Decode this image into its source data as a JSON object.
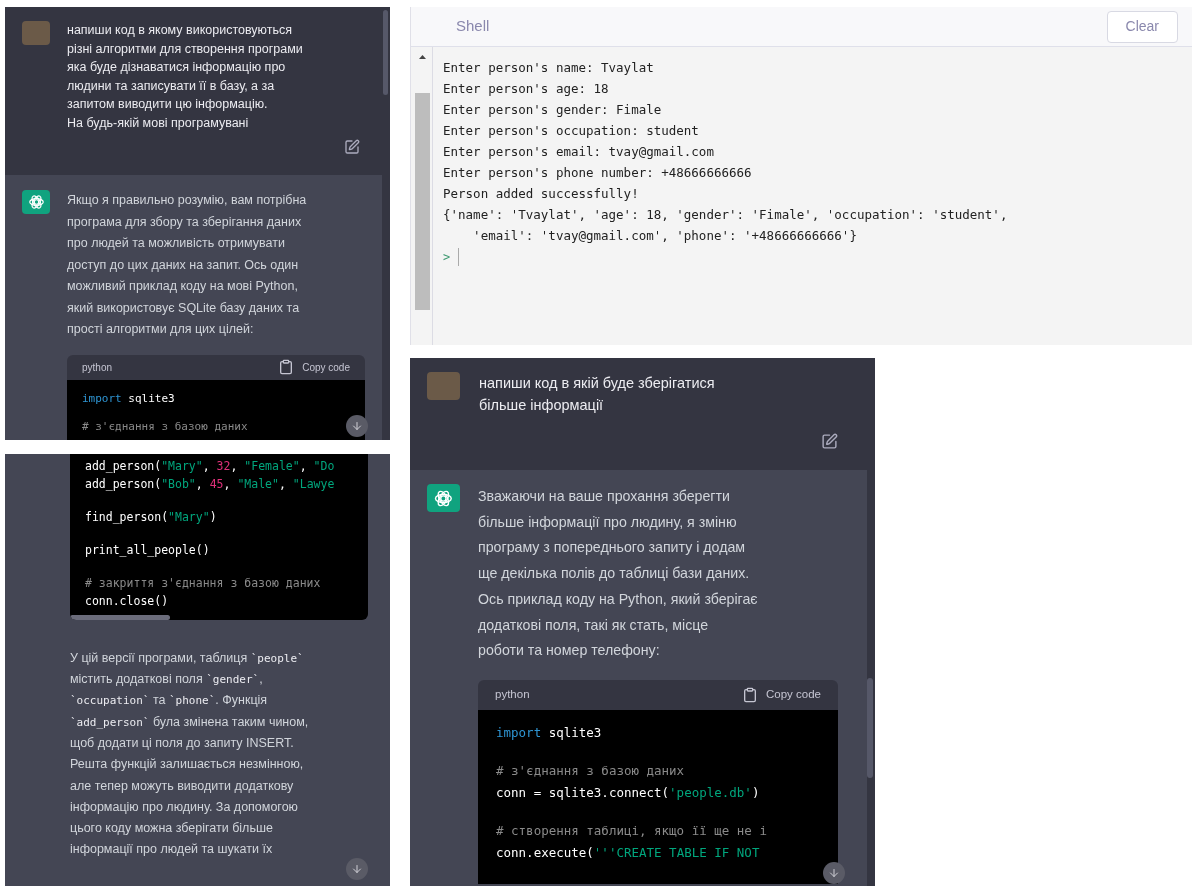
{
  "chat_top": {
    "user_message": "напиши код в якому використовуються\nрізні алгоритми для створення програми\nяка буде дізнаватися інформацію про\nлюдини та записувати її в базу, а за\nзапитом виводити цю інформацію.\nНа будь-якій мові програмувані",
    "assistant_message": "Якщо я правильно розумію, вам потрібна\nпрограма для збору та зберігання даних\nпро людей та можливість отримувати\nдоступ до цих даних на запит. Ось один\nможливий приклад коду на мові Python,\nякий використовує SQLite базу даних та\nпрості алгоритми для цих цілей:",
    "code": {
      "language": "python",
      "copy_label": "Copy code",
      "lines": [
        {
          "kind": "code",
          "tokens": [
            {
              "kind": "keyword",
              "text": "import"
            },
            {
              "kind": "plain",
              "text": " sqlite3"
            }
          ]
        },
        {
          "kind": "blank"
        },
        {
          "kind": "code",
          "tokens": [
            {
              "kind": "comment",
              "text": "# з'єднання з базою даних"
            }
          ]
        }
      ]
    }
  },
  "shell": {
    "title": "Shell",
    "clear_label": "Clear",
    "lines": [
      "Enter person's name: Tvaylat",
      "Enter person's age: 18",
      "Enter person's gender: Fimale",
      "Enter person's occupation: student",
      "Enter person's email: tvay@gmail.com",
      "Enter person's phone number: +48666666666",
      "Person added successfully!",
      "{'name': 'Tvaylat', 'age': 18, 'gender': 'Fimale', 'occupation': 'student',",
      "    'email': 'tvay@gmail.com', 'phone': '+48666666666'}"
    ],
    "prompt": ">"
  },
  "chat_bottom_left": {
    "code": {
      "lines": [
        {
          "kind": "code",
          "tokens": [
            {
              "kind": "plain",
              "text": "add_person("
            },
            {
              "kind": "string",
              "text": "\"Mary\""
            },
            {
              "kind": "plain",
              "text": ", "
            },
            {
              "kind": "number",
              "text": "32"
            },
            {
              "kind": "plain",
              "text": ", "
            },
            {
              "kind": "string",
              "text": "\"Female\""
            },
            {
              "kind": "plain",
              "text": ", "
            },
            {
              "kind": "string",
              "text": "\"Do"
            }
          ]
        },
        {
          "kind": "code",
          "tokens": [
            {
              "kind": "plain",
              "text": "add_person("
            },
            {
              "kind": "string",
              "text": "\"Bob\""
            },
            {
              "kind": "plain",
              "text": ", "
            },
            {
              "kind": "number",
              "text": "45"
            },
            {
              "kind": "plain",
              "text": ", "
            },
            {
              "kind": "string",
              "text": "\"Male\""
            },
            {
              "kind": "plain",
              "text": ", "
            },
            {
              "kind": "string",
              "text": "\"Lawye"
            }
          ]
        },
        {
          "kind": "blank"
        },
        {
          "kind": "code",
          "tokens": [
            {
              "kind": "plain",
              "text": "find_person("
            },
            {
              "kind": "string",
              "text": "\"Mary\""
            },
            {
              "kind": "plain",
              "text": ")"
            }
          ]
        },
        {
          "kind": "blank"
        },
        {
          "kind": "code",
          "tokens": [
            {
              "kind": "plain",
              "text": "print_all_people()"
            }
          ]
        },
        {
          "kind": "blank"
        },
        {
          "kind": "code",
          "tokens": [
            {
              "kind": "comment",
              "text": "# закриття з'єднання з базою даних"
            }
          ]
        },
        {
          "kind": "code",
          "tokens": [
            {
              "kind": "plain",
              "text": "conn.close()"
            }
          ]
        }
      ]
    },
    "assistant_message": [
      {
        "kind": "text",
        "text": "У цій версії програми, таблиця "
      },
      {
        "kind": "code",
        "text": "`people`"
      },
      {
        "kind": "text",
        "text": "\nмістить додаткові поля "
      },
      {
        "kind": "code",
        "text": "`gender`"
      },
      {
        "kind": "text",
        "text": ",\n"
      },
      {
        "kind": "code",
        "text": "`occupation`"
      },
      {
        "kind": "text",
        "text": " та "
      },
      {
        "kind": "code",
        "text": "`phone`"
      },
      {
        "kind": "text",
        "text": ". Функція\n"
      },
      {
        "kind": "code",
        "text": "`add_person`"
      },
      {
        "kind": "text",
        "text": " була змінена таким чином,\nщоб додати ці поля до запиту INSERT.\nРешта функцій залишається незмінною,\nале тепер можуть виводити додаткову\nінформацію про людину. За допомогою\nцього коду можна зберігати більше\nінформації про людей та шукати їх"
      }
    ]
  },
  "chat_bottom_right": {
    "user_message": "напиши код в якій буде зберігатися\nбільше інформації",
    "assistant_message": "Зважаючи на ваше прохання зберегти\nбільше інформації про людину, я зміню\nпрограму з попереднього запиту і додам\nще декілька полів до таблиці бази даних.\nОсь приклад коду на Python, який зберігає\nдодаткові поля, такі як стать, місце\nроботи та номер телефону:",
    "code": {
      "language": "python",
      "copy_label": "Copy code",
      "lines": [
        {
          "kind": "code",
          "tokens": [
            {
              "kind": "keyword",
              "text": "import"
            },
            {
              "kind": "plain",
              "text": " sqlite3"
            }
          ]
        },
        {
          "kind": "blank"
        },
        {
          "kind": "code",
          "tokens": [
            {
              "kind": "comment",
              "text": "# з'єднання з базою даних"
            }
          ]
        },
        {
          "kind": "code",
          "tokens": [
            {
              "kind": "plain",
              "text": "conn = sqlite3.connect("
            },
            {
              "kind": "string",
              "text": "'people.db'"
            },
            {
              "kind": "plain",
              "text": ")"
            }
          ]
        },
        {
          "kind": "blank"
        },
        {
          "kind": "code",
          "tokens": [
            {
              "kind": "comment",
              "text": "# створення таблиці, якщо її ще не і"
            }
          ]
        },
        {
          "kind": "code",
          "tokens": [
            {
              "kind": "plain",
              "text": "conn.execute("
            },
            {
              "kind": "string",
              "text": "'''CREATE TABLE IF NOT"
            }
          ]
        }
      ]
    }
  }
}
